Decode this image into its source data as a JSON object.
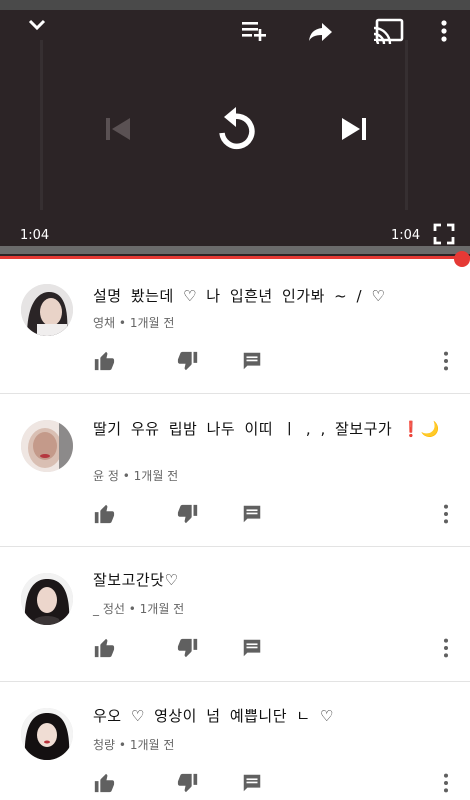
{
  "player": {
    "current_time": "1:04",
    "duration": "1:04",
    "progress": 1.0,
    "icons": [
      "chevron-down-icon",
      "add-to-queue-icon",
      "share-icon",
      "cast-icon",
      "more-vert-icon",
      "skip-previous-icon",
      "replay-icon",
      "skip-next-icon",
      "fullscreen-icon"
    ]
  },
  "comments": [
    {
      "text": "설명 봤는데 ♡ 나 입흔년 인가봐 ~ / ♡",
      "author": "영채",
      "age": "1개월 전"
    },
    {
      "text": "딸기 우유 립밤 나두 이띠    ㅣ    , , 잘보구가 ❗🌙",
      "author": "윤 정",
      "age": "1개월 전"
    },
    {
      "text": "잘보고간닷♡",
      "author": "_ 정선",
      "age": "1개월 전"
    },
    {
      "text": "우오   ♡   영상이  넘  예쁩니단  ㄴ ♡",
      "author": "청량",
      "age": "1개월 전"
    }
  ],
  "meta_separator": "•",
  "colors": {
    "accent": "#e53935",
    "player_bg": "#2c2426",
    "icon_gray": "#606060"
  }
}
